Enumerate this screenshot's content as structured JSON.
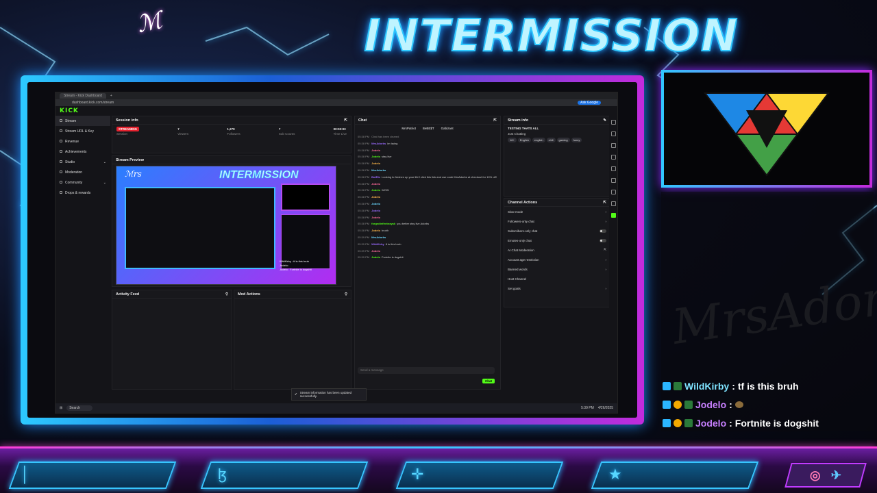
{
  "overlay": {
    "title": "INTERMISSION",
    "signature": "MrsAdorbs",
    "chat": [
      {
        "user": "WildKirby",
        "message": "tf is this bruh",
        "emoji": false
      },
      {
        "user": "Jodelo",
        "message": "",
        "emoji": true
      },
      {
        "user": "Jodelo",
        "message": "Fortnite is dogshit",
        "emoji": false
      }
    ],
    "colors": {
      "cyan": "#35c8ff",
      "magenta": "#c22bdc",
      "kick_green": "#53fc18"
    }
  },
  "browser": {
    "tab_title": "Stream - Kick Dashboard",
    "url": "dashboard.kick.com/stream",
    "ask_google": "Ask Google"
  },
  "kick": {
    "logo": "KICK",
    "sidebar": [
      {
        "label": "Stream",
        "icon": "stream-icon"
      },
      {
        "label": "Stream URL & Key",
        "icon": "key-icon"
      },
      {
        "label": "Revenue",
        "icon": "revenue-icon"
      },
      {
        "label": "Achievements",
        "icon": "trophy-icon"
      },
      {
        "label": "Studio",
        "icon": "studio-icon"
      },
      {
        "label": "Moderation",
        "icon": "shield-icon"
      },
      {
        "label": "Community",
        "icon": "community-icon"
      },
      {
        "label": "Drops & rewards",
        "icon": "gift-icon"
      }
    ],
    "session": {
      "title": "Session info",
      "status": "STREAMING",
      "status_label": "Session",
      "stats": [
        {
          "value": "7",
          "label": "Viewers"
        },
        {
          "value": "1,279",
          "label": "Followers"
        },
        {
          "value": "7",
          "label": "Sub Counts"
        },
        {
          "value": "00:02:03",
          "label": "Time Live"
        }
      ]
    },
    "preview": {
      "title": "Stream Preview"
    },
    "activity": {
      "title": "Activity Feed"
    },
    "mod_actions": {
      "title": "Mod Actions"
    },
    "chat": {
      "title": "Chat",
      "top_users": [
        "MrsPatriot",
        "BeBE$T",
        "Gabizant"
      ],
      "cleared": "Chat has been cleared",
      "lines": [
        {
          "time": "05:38 PM",
          "user": "MrsAdorbs",
          "text": "im trying"
        },
        {
          "time": "05:38 PM",
          "user": "Jodelo",
          "text": ""
        },
        {
          "time": "05:38 PM",
          "user": "Jodelo",
          "text": "stay live"
        },
        {
          "time": "05:38 PM",
          "user": "Jodelo",
          "text": ""
        },
        {
          "time": "05:38 PM",
          "user": "MrsAdorbs",
          "text": ""
        },
        {
          "time": "05:38 PM",
          "user": "BotRix",
          "text": "Looking to freshen up your life!! click this link and use code MrsAdorbs at checkout for 10% off!"
        },
        {
          "time": "05:38 PM",
          "user": "Jodelo",
          "text": ""
        },
        {
          "time": "05:38 PM",
          "user": "Jodelo",
          "text": "WOW"
        },
        {
          "time": "05:38 PM",
          "user": "Jodelo",
          "text": ""
        },
        {
          "time": "05:38 PM",
          "user": "Jodelo",
          "text": ""
        },
        {
          "time": "05:38 PM",
          "user": "Jodelo",
          "text": ""
        },
        {
          "time": "05:38 PM",
          "user": "Jodelo",
          "text": ""
        },
        {
          "time": "05:38 PM",
          "user": "forgedinfirebraysk",
          "text": "you better stay live Adorbs"
        },
        {
          "time": "05:38 PM",
          "user": "Jodelo",
          "text": "bruhh"
        },
        {
          "time": "05:39 PM",
          "user": "MrsAdorbs",
          "text": ""
        },
        {
          "time": "05:39 PM",
          "user": "WildKirby",
          "text": "tf is this bruh"
        },
        {
          "time": "05:39 PM",
          "user": "Jodelo",
          "text": ""
        },
        {
          "time": "05:39 PM",
          "user": "Jodelo",
          "text": "Fortnite is dogshit"
        }
      ],
      "input_placeholder": "Send a message",
      "send": "Chat"
    },
    "stream_info": {
      "title": "Stream info",
      "stream_title": "TESTING THATS ALL",
      "category": "Just Chatting",
      "tags": [
        "18+",
        "English",
        "english",
        "chill",
        "gaming",
        "funny"
      ]
    },
    "channel_actions": {
      "title": "Channel Actions",
      "items": [
        {
          "label": "Slow mode",
          "control": "arrow"
        },
        {
          "label": "Followers-only chat",
          "control": "arrow"
        },
        {
          "label": "Subscribers-only chat",
          "control": "toggle"
        },
        {
          "label": "Emotes-only chat",
          "control": "toggle"
        },
        {
          "label": "AI Chat Moderation",
          "control": "external"
        },
        {
          "label": "Account age restriction",
          "control": "arrow"
        },
        {
          "label": "Banned words",
          "control": "arrow"
        },
        {
          "label": "Host Channel",
          "control": "none"
        },
        {
          "label": "Set goals",
          "control": "arrow"
        }
      ]
    },
    "toast": "Stream information has been updated successfully."
  },
  "taskbar": {
    "search": "Search",
    "time": "5:39 PM",
    "date": "4/26/2025"
  }
}
